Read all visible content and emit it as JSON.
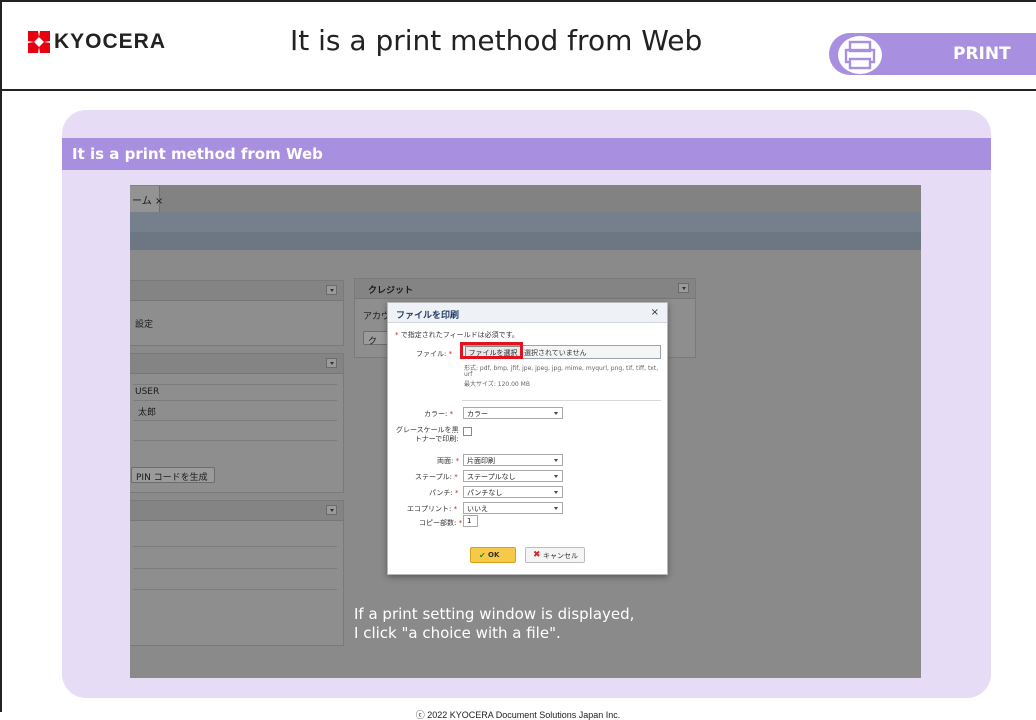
{
  "header": {
    "logo_text": "KYOCERA",
    "title": "It is a print method from Web",
    "badge_label": "PRINT"
  },
  "panel": {
    "title": "It is a print method from Web"
  },
  "screenshot": {
    "tab_label": "ーム ×",
    "cards": {
      "card1_text": "設定",
      "credit_title": "クレジット",
      "credit_account": "アカウ",
      "credit_button": "ク",
      "user_text": "USER",
      "name_text": "太郎",
      "pin_button": "PIN コードを生成"
    },
    "dialog": {
      "title": "ファイルを印刷",
      "close": "×",
      "required_note": "で指定されたフィールドは必須です。",
      "required_mark": "*",
      "file_label": "ファイル:",
      "file_button": "ファイルを選択",
      "file_none": "選択されていません",
      "formats": "形式: pdf, bmp, jfif, jpe, jpeg, jpg, mime, myqurl, png, tif, tiff, txt,",
      "formats_2": "urf",
      "max_size": "最大サイズ: 120.00 MB",
      "color_label": "カラー:",
      "color_value": "カラー",
      "grayscale_label_1": "グレースケールを黒",
      "grayscale_label_2": "トナーで印刷:",
      "duplex_label": "両面:",
      "duplex_value": "片面印刷",
      "staple_label": "ステープル:",
      "staple_value": "ステープルなし",
      "punch_label": "パンチ:",
      "punch_value": "パンチなし",
      "ecoprint_label": "エコプリント:",
      "ecoprint_value": "いいえ",
      "copies_label": "コピー部数:",
      "copies_value": "1",
      "ok_label": "OK",
      "cancel_label": "キャンセル"
    }
  },
  "caption": {
    "line1": "If a print setting window is displayed,",
    "line2": "I click \"a choice with a file\"."
  },
  "footer": {
    "copyright": "ⓒ 2022 KYOCERA Document Solutions Japan Inc."
  },
  "colors": {
    "accent_purple": "#a98fdf",
    "panel_bg": "#e7dcf5",
    "highlight_red": "#e0141e",
    "logo_red": "#e60012"
  }
}
